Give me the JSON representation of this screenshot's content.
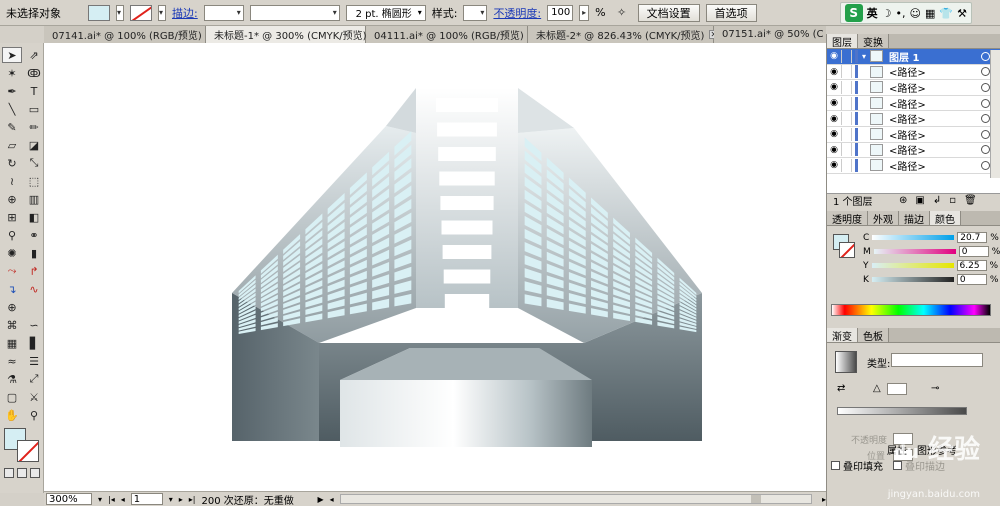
{
  "control_bar": {
    "selection_label": "未选择对象",
    "stroke_label": "描边:",
    "brush_value": "2 pt. 椭圆形",
    "style_label": "样式:",
    "opacity_label": "不透明度:",
    "opacity_value": "100",
    "opacity_unit": "%",
    "doc_setup_button": "文档设置",
    "prefs_button": "首选项",
    "ime_label": "英"
  },
  "tabs": [
    {
      "label": "07141.ai* @ 100% (RGB/预览)"
    },
    {
      "label": "未标题-1* @ 300% (CMYK/预览)"
    },
    {
      "label": "04111.ai* @ 100% (RGB/预览)"
    },
    {
      "label": "未标题-2* @ 826.43% (CMYK/预览)"
    },
    {
      "label": "07151.ai* @ 50% (C"
    }
  ],
  "active_tab_index": 1,
  "status": {
    "zoom": "300%",
    "page": "1",
    "undo_text": "200 次还原：无重做"
  },
  "layers_panel": {
    "tab_layers": "图层",
    "tab_swap": "变换",
    "layer_name": "图层 1",
    "paths": [
      "<路径>",
      "<路径>",
      "<路径>",
      "<路径>",
      "<路径>",
      "<路径>",
      "<路径>"
    ],
    "footer": "1 个图层"
  },
  "color_panel": {
    "tabs": [
      "透明度",
      "外观",
      "描边",
      "颜色"
    ],
    "C_label": "C",
    "C_value": "20.7",
    "M_label": "M",
    "M_value": "0",
    "Y_label": "Y",
    "Y_value": "6.25",
    "K_label": "K",
    "K_value": "0",
    "unit": "%"
  },
  "gradient_panel": {
    "tabs": [
      "渐变",
      "色板"
    ],
    "type_label": "类型:",
    "opacity_label": "不透明度",
    "position_label": "位置"
  },
  "bottom_panel": {
    "overprint_fill": "叠印填充",
    "overprint_stroke": "叠印描边",
    "tab_label": "属性",
    "tab_label2": "图形参考"
  },
  "watermark": "经验",
  "watermark_sub": "jingyan.baidu.com",
  "colors": {
    "fill": "#d5eef3",
    "window": "#d9f0f4",
    "accent": "#3a6fd1"
  }
}
